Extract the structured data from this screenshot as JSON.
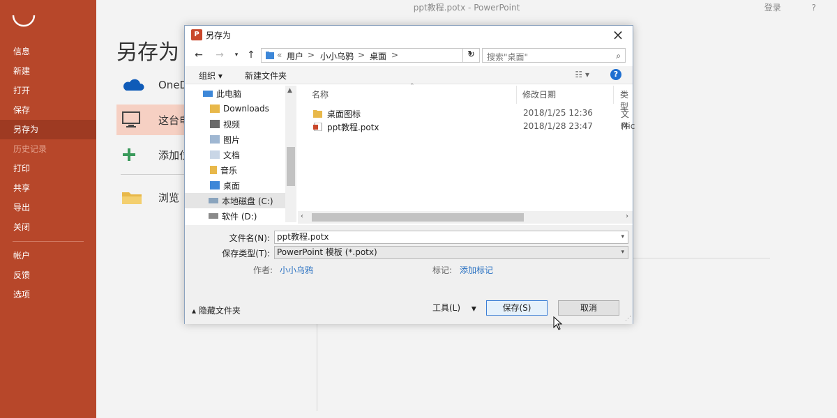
{
  "app": {
    "window_title": "ppt教程.potx  -  PowerPoint",
    "top_right": [
      "登录",
      "?"
    ]
  },
  "sidebar": {
    "items": [
      {
        "label": "信息"
      },
      {
        "label": "新建"
      },
      {
        "label": "打开"
      },
      {
        "label": "保存"
      },
      {
        "label": "另存为"
      },
      {
        "label": "历史记录"
      },
      {
        "label": "打印"
      },
      {
        "label": "共享"
      },
      {
        "label": "导出"
      },
      {
        "label": "关闭"
      },
      {
        "label": "帐户"
      },
      {
        "label": "反馈"
      },
      {
        "label": "选项"
      }
    ]
  },
  "backstage": {
    "title": "另存为",
    "places": [
      {
        "label": "OneD",
        "icon": "onedrive-icon"
      },
      {
        "label": "这台电",
        "icon": "computer-icon"
      },
      {
        "label": "添加位",
        "icon": "add-icon"
      },
      {
        "label": "浏览",
        "icon": "folder-icon"
      }
    ]
  },
  "dialog": {
    "title": "另存为",
    "address": {
      "prefix": "«",
      "crumbs": [
        "用户",
        "小小乌鸦",
        "桌面"
      ],
      "separator": ">"
    },
    "search_placeholder": "搜索\"桌面\"",
    "toolbar": {
      "organize": "组织 ▾",
      "new_folder": "新建文件夹"
    },
    "tree": [
      {
        "label": "此电脑",
        "icon": "pc-icon"
      },
      {
        "label": "Downloads",
        "icon": "downloads-icon"
      },
      {
        "label": "视频",
        "icon": "videos-icon"
      },
      {
        "label": "图片",
        "icon": "pictures-icon"
      },
      {
        "label": "文档",
        "icon": "documents-icon"
      },
      {
        "label": "音乐",
        "icon": "music-icon"
      },
      {
        "label": "桌面",
        "icon": "desktop-icon"
      },
      {
        "label": "本地磁盘 (C:)",
        "icon": "drive-icon"
      },
      {
        "label": "软件 (D:)",
        "icon": "drive-icon"
      }
    ],
    "columns": [
      "名称",
      "修改日期",
      "类型"
    ],
    "files": [
      {
        "name": "桌面图标",
        "date": "2018/1/25 12:36",
        "type": "文件",
        "icon": "folder-icon"
      },
      {
        "name": "ppt教程.potx",
        "date": "2018/1/28 23:47",
        "type": "Mic",
        "icon": "pptx-file-icon"
      }
    ],
    "filename_label": "文件名(N):",
    "filename_value": "ppt教程.potx",
    "filetype_label": "保存类型(T):",
    "filetype_value": "PowerPoint 模板 (*.potx)",
    "author_label": "作者:",
    "author_value": "小小乌鸦",
    "tags_label": "标记:",
    "tags_value": "添加标记",
    "hide_folders": "隐藏文件夹",
    "tools": "工具(L)",
    "save": "保存(S)",
    "cancel": "取消"
  },
  "colors": {
    "sidebar_bg": "#b7472a",
    "sidebar_active": "#9e3a22",
    "place_active": "#f6d0c3",
    "link": "#2b72c2"
  }
}
